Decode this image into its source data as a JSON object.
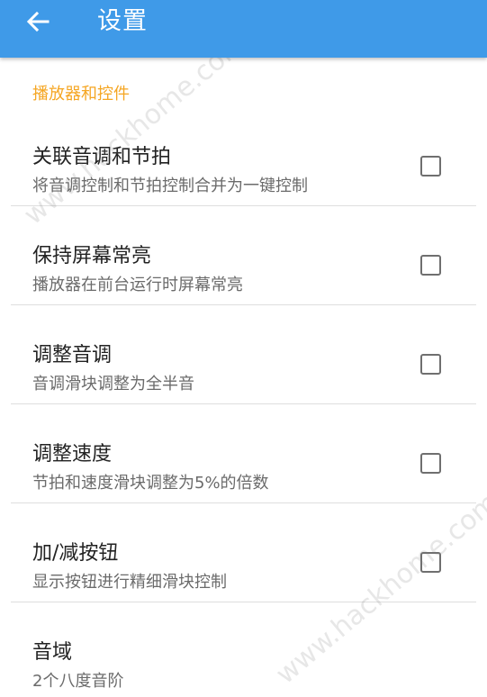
{
  "toolbar": {
    "title": "设置",
    "back_icon": "arrow-left-icon",
    "color": "#3f9ae8"
  },
  "section": {
    "header": "播放器和控件",
    "header_color": "#f5a623"
  },
  "settings": [
    {
      "title": "关联音调和节拍",
      "summary": "将音调控制和节拍控制合并为一键控制",
      "checked": false
    },
    {
      "title": "保持屏幕常亮",
      "summary": "播放器在前台运行时屏幕常亮",
      "checked": false
    },
    {
      "title": "调整音调",
      "summary": "音调滑块调整为全半音",
      "checked": false
    },
    {
      "title": "调整速度",
      "summary": "节拍和速度滑块调整为5%的倍数",
      "checked": false
    },
    {
      "title": "加/减按钮",
      "summary": "显示按钮进行精细滑块控制",
      "checked": false
    },
    {
      "title": "音域",
      "summary": "2个八度音阶"
    }
  ],
  "watermark": {
    "text": "www.hackhome.com"
  }
}
